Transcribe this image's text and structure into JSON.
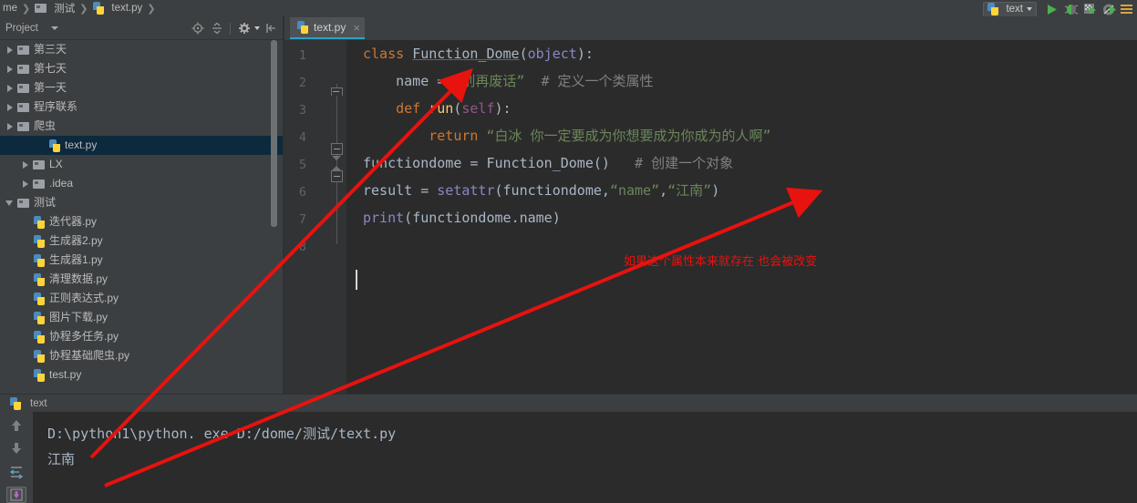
{
  "window": {
    "breadcrumb": [
      {
        "label": "me",
        "icon": "none"
      },
      {
        "label": "测试",
        "icon": "folder-icon"
      },
      {
        "label": "text.py",
        "icon": "python-file-icon"
      }
    ],
    "run_config": {
      "name": "text",
      "icon": "python-file-icon"
    },
    "toolbar_icons": [
      "run-icon",
      "debug-icon",
      "coverage-icon",
      "profile-icon",
      "menu-icon"
    ]
  },
  "project_panel": {
    "title": "Project",
    "tool_icons": [
      "locate-icon",
      "collapse-all-icon",
      "settings-gear-icon",
      "hide-icon"
    ],
    "tree": [
      {
        "label": "test.py",
        "icon": "python-file-icon",
        "indent": 1,
        "twisty": "none",
        "selected": false
      },
      {
        "label": "协程基础爬虫.py",
        "icon": "python-file-icon",
        "indent": 1,
        "twisty": "none",
        "selected": false
      },
      {
        "label": "协程多任务.py",
        "icon": "python-file-icon",
        "indent": 1,
        "twisty": "none",
        "selected": false
      },
      {
        "label": "图片下载.py",
        "icon": "python-file-icon",
        "indent": 1,
        "twisty": "none",
        "selected": false
      },
      {
        "label": "正则表达式.py",
        "icon": "python-file-icon",
        "indent": 1,
        "twisty": "none",
        "selected": false
      },
      {
        "label": "清理数据.py",
        "icon": "python-file-icon",
        "indent": 1,
        "twisty": "none",
        "selected": false
      },
      {
        "label": "生成器1.py",
        "icon": "python-file-icon",
        "indent": 1,
        "twisty": "none",
        "selected": false
      },
      {
        "label": "生成器2.py",
        "icon": "python-file-icon",
        "indent": 1,
        "twisty": "none",
        "selected": false
      },
      {
        "label": "迭代器.py",
        "icon": "python-file-icon",
        "indent": 1,
        "twisty": "none",
        "selected": false
      },
      {
        "label": "测试",
        "icon": "folder-icon",
        "indent": 0,
        "twisty": "open",
        "selected": false
      },
      {
        "label": ".idea",
        "icon": "folder-icon",
        "indent": 1,
        "twisty": "closed",
        "selected": false
      },
      {
        "label": "LX",
        "icon": "folder-icon",
        "indent": 1,
        "twisty": "closed",
        "selected": false
      },
      {
        "label": "text.py",
        "icon": "python-file-icon",
        "indent": 2,
        "twisty": "none",
        "selected": true
      },
      {
        "label": "爬虫",
        "icon": "folder-icon",
        "indent": 0,
        "twisty": "closed",
        "selected": false
      },
      {
        "label": "程序联系",
        "icon": "folder-icon",
        "indent": 0,
        "twisty": "closed",
        "selected": false
      },
      {
        "label": "第一天",
        "icon": "folder-icon",
        "indent": 0,
        "twisty": "closed",
        "selected": false
      },
      {
        "label": "第七天",
        "icon": "folder-icon",
        "indent": 0,
        "twisty": "closed",
        "selected": false
      },
      {
        "label": "第三天",
        "icon": "folder-icon",
        "indent": 0,
        "twisty": "closed",
        "selected": false
      }
    ]
  },
  "editor": {
    "tab": {
      "label": "text.py",
      "icon": "python-file-icon",
      "close": "×",
      "active": true
    },
    "line_numbers": [
      "1",
      "2",
      "3",
      "4",
      "5",
      "6",
      "7",
      "8"
    ],
    "lines": [
      {
        "n": "1",
        "segments": [
          {
            "t": "class ",
            "c": "kw"
          },
          {
            "t": "Function_Dome",
            "c": "cls"
          },
          {
            "t": "(",
            "c": "op"
          },
          {
            "t": "object",
            "c": "bi"
          },
          {
            "t": "):",
            "c": "op"
          }
        ]
      },
      {
        "n": "2",
        "segments": [
          {
            "t": "    name ",
            "c": "id"
          },
          {
            "t": "= ",
            "c": "op"
          },
          {
            "t": "“别再废话”",
            "c": "str"
          },
          {
            "t": "  # 定义一个类属性",
            "c": "cmt"
          }
        ]
      },
      {
        "n": "3",
        "segments": [
          {
            "t": "    ",
            "c": "id"
          },
          {
            "t": "def ",
            "c": "kw"
          },
          {
            "t": "run",
            "c": "fn"
          },
          {
            "t": "(",
            "c": "op"
          },
          {
            "t": "self",
            "c": "self"
          },
          {
            "t": "):",
            "c": "op"
          }
        ]
      },
      {
        "n": "4",
        "segments": [
          {
            "t": "        ",
            "c": "id"
          },
          {
            "t": "return ",
            "c": "kw"
          },
          {
            "t": "“白冰 你一定要成为你想要成为你成为的人啊”",
            "c": "str"
          }
        ]
      },
      {
        "n": "5",
        "segments": [
          {
            "t": "functiondome ",
            "c": "id"
          },
          {
            "t": "= ",
            "c": "op"
          },
          {
            "t": "Function_Dome",
            "c": "id"
          },
          {
            "t": "()",
            "c": "op"
          },
          {
            "t": "   # 创建一个对象",
            "c": "cmt"
          }
        ]
      },
      {
        "n": "6",
        "segments": [
          {
            "t": "result ",
            "c": "id"
          },
          {
            "t": "= ",
            "c": "op"
          },
          {
            "t": "setattr",
            "c": "bi"
          },
          {
            "t": "(",
            "c": "op"
          },
          {
            "t": "functiondome",
            "c": "id"
          },
          {
            "t": ",",
            "c": "op"
          },
          {
            "t": "“name”",
            "c": "str"
          },
          {
            "t": ",",
            "c": "op"
          },
          {
            "t": "“江南”",
            "c": "str"
          },
          {
            "t": ")",
            "c": "op"
          }
        ]
      },
      {
        "n": "7",
        "segments": [
          {
            "t": "print",
            "c": "bi"
          },
          {
            "t": "(",
            "c": "op"
          },
          {
            "t": "functiondome",
            "c": "id"
          },
          {
            "t": ".name)",
            "c": "op"
          }
        ]
      },
      {
        "n": "8",
        "segments": []
      }
    ],
    "annotation": {
      "text": "如果这个属性本来就存在 也会被改变",
      "color": "#e8120e"
    }
  },
  "run_panel": {
    "tab_label": "text",
    "tab_icon": "python-file-icon",
    "side_buttons": [
      "up-arrow-icon",
      "down-arrow-icon",
      "soft-wrap-icon",
      "scroll-to-end-icon"
    ],
    "console_lines": [
      "D:\\python1\\python. exe D:/dome/测试/text.py",
      "江南"
    ]
  },
  "colors": {
    "accent": "#2aa3c7",
    "selection": "#0d293e",
    "editor_bg": "#2b2b2b",
    "panel_bg": "#3c3f41",
    "annotation_red": "#e8120e",
    "string_green": "#6a8759",
    "keyword_orange": "#cc7832"
  }
}
